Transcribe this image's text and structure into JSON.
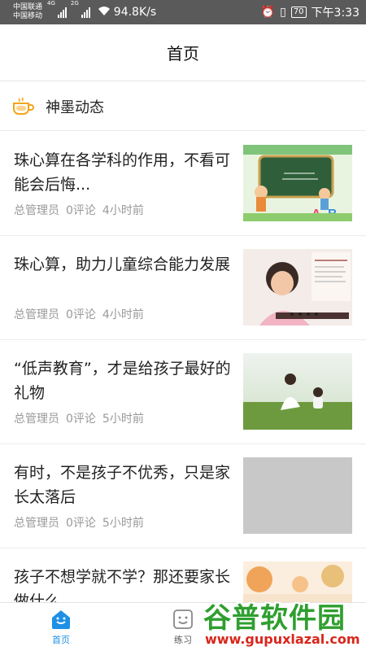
{
  "status_bar": {
    "carrier_1": "中国联通",
    "carrier_2": "中国移动",
    "network_1": "4G",
    "network_2": "2G",
    "speed": "94.8K/s",
    "battery": "70",
    "time": "下午3:33"
  },
  "header": {
    "title": "首页"
  },
  "section": {
    "title": "神墨动态",
    "icon": "coffee-cup-icon",
    "icon_color": "#f3a51b"
  },
  "articles": [
    {
      "title": "珠心算在各学科的作用，不看可能会后悔...",
      "author": "总管理员",
      "comments": "0评论",
      "time": "4小时前",
      "thumb": "classroom-cartoon"
    },
    {
      "title": "珠心算，助力儿童综合能力发展",
      "author": "总管理员",
      "comments": "0评论",
      "time": "4小时前",
      "thumb": "girl-abacus-photo"
    },
    {
      "title": "“低声教育”，才是给孩子最好的礼物",
      "author": "总管理员",
      "comments": "0评论",
      "time": "5小时前",
      "thumb": "mother-child-grass-photo"
    },
    {
      "title": "有时，不是孩子不优秀，只是家长太落后",
      "author": "总管理员",
      "comments": "0评论",
      "time": "5小时前",
      "thumb": "placeholder-gray"
    },
    {
      "title": "孩子不想学就不学？那还要家长做什么",
      "author": "",
      "comments": "",
      "time": "",
      "thumb": "autumn-illustration"
    }
  ],
  "bottom_nav": [
    {
      "label": "首页",
      "icon": "home-icon",
      "active": true
    },
    {
      "label": "练习",
      "icon": "practice-icon",
      "active": false
    },
    {
      "label": "",
      "icon": "",
      "active": false
    }
  ],
  "watermark": {
    "text": "谷普软件园",
    "url": "www.gupuxlazal.com"
  },
  "colors": {
    "accent": "#1e90e6",
    "status_bar": "#5a5a5a",
    "meta_text": "#999999"
  }
}
